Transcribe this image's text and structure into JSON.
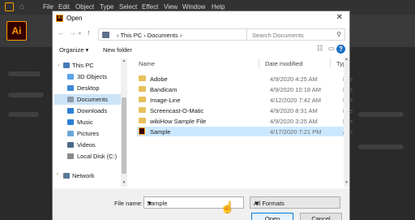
{
  "illustrator": {
    "logo": "Ai",
    "menu": [
      "File",
      "Edit",
      "Object",
      "Type",
      "Select",
      "Effect",
      "View",
      "Window",
      "Help"
    ],
    "accent": "#ff9a00"
  },
  "dialog": {
    "title": "Open",
    "breadcrumb": [
      "This PC",
      "Documents"
    ],
    "search_placeholder": "Search Documents",
    "organize_label": "Organize ▾",
    "new_folder_label": "New folder",
    "help_label": "?",
    "sidebar": [
      {
        "label": "This PC",
        "icon": "pc-icon",
        "color": "#4a7ab8"
      },
      {
        "label": "3D Objects",
        "icon": "cube-icon",
        "color": "#5aa2e6"
      },
      {
        "label": "Desktop",
        "icon": "desktop-icon",
        "color": "#3b8ad6"
      },
      {
        "label": "Documents",
        "icon": "documents-icon",
        "color": "#8a99a8",
        "selected": true
      },
      {
        "label": "Downloads",
        "icon": "downloads-icon",
        "color": "#2d7fd6"
      },
      {
        "label": "Music",
        "icon": "music-icon",
        "color": "#2d7fd6"
      },
      {
        "label": "Pictures",
        "icon": "pictures-icon",
        "color": "#6aa7d8"
      },
      {
        "label": "Videos",
        "icon": "videos-icon",
        "color": "#4a6a8a"
      },
      {
        "label": "Local Disk (C:)",
        "icon": "disk-icon",
        "color": "#8a8a8a"
      },
      {
        "label": "Network",
        "icon": "network-icon",
        "color": "#5a7a9a"
      }
    ],
    "columns": {
      "name": "Name",
      "date": "Date modified",
      "type": "Type"
    },
    "files": [
      {
        "name": "Adobe",
        "date": "4/9/2020 4:25 AM",
        "type": "File fo",
        "icon": "folder-icon",
        "color": "#e8c15a"
      },
      {
        "name": "Bandicam",
        "date": "4/9/2020 10:18 AM",
        "type": "File fo",
        "icon": "folder-icon",
        "color": "#e8c15a"
      },
      {
        "name": "Image-Line",
        "date": "4/12/2020 7:42 AM",
        "type": "File fo",
        "icon": "folder-icon",
        "color": "#e8c15a"
      },
      {
        "name": "Screencast-O-Matic",
        "date": "4/9/2020 8:31 AM",
        "type": "File fo",
        "icon": "folder-icon",
        "color": "#e8c15a"
      },
      {
        "name": "wikiHow Sample File",
        "date": "4/9/2020 3:25 AM",
        "type": "File fo",
        "icon": "folder-icon",
        "color": "#e8c15a"
      },
      {
        "name": "Sample",
        "date": "4/17/2020 7:21 PM",
        "type": "Adobe",
        "icon": "ai-file-icon",
        "color": "#330000",
        "selected": true
      }
    ],
    "file_name_label": "File name:",
    "file_name_value": "Sample",
    "format_value": "All Formats",
    "open_label": "Open",
    "cancel_label": "Cancel"
  }
}
